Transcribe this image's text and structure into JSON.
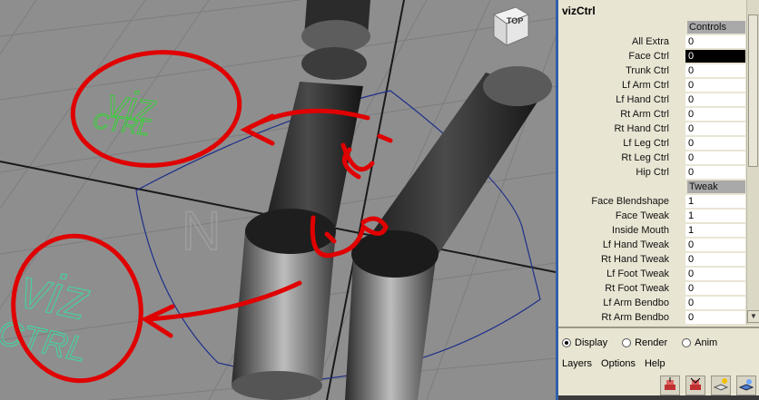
{
  "viewport": {
    "view_cube_label": "TOP",
    "view_cube_sub": "vizCtrl",
    "annotation_arrow_text": "من هنا"
  },
  "channel_box": {
    "title": "vizCtrl",
    "groups": [
      {
        "header": "Controls",
        "attributes": [
          {
            "label": "All Extra",
            "value": "0"
          },
          {
            "label": "Face Ctrl",
            "value": "0",
            "selected": true
          },
          {
            "label": "Trunk Ctrl",
            "value": "0"
          },
          {
            "label": "Lf Arm Ctrl",
            "value": "0"
          },
          {
            "label": "Lf Hand Ctrl",
            "value": "0"
          },
          {
            "label": "Rt Arm Ctrl",
            "value": "0"
          },
          {
            "label": "Rt Hand Ctrl",
            "value": "0"
          },
          {
            "label": "Lf Leg Ctrl",
            "value": "0"
          },
          {
            "label": "Rt Leg Ctrl",
            "value": "0"
          },
          {
            "label": "Hip Ctrl",
            "value": "0"
          }
        ]
      },
      {
        "header": "Tweak",
        "attributes": [
          {
            "label": "Face Blendshape",
            "value": "1"
          },
          {
            "label": "Face Tweak",
            "value": "1"
          },
          {
            "label": "Inside Mouth",
            "value": "1"
          },
          {
            "label": "Lf Hand Tweak",
            "value": "0"
          },
          {
            "label": "Rt Hand Tweak",
            "value": "0"
          },
          {
            "label": "Lf Foot Tweak",
            "value": "0"
          },
          {
            "label": "Rt Foot Tweak",
            "value": "0"
          },
          {
            "label": "Lf Arm Bendbo",
            "value": "0"
          },
          {
            "label": "Rt Arm Bendbo",
            "value": "0"
          }
        ]
      }
    ]
  },
  "layer_editor": {
    "modes": [
      {
        "label": "Display",
        "selected": true
      },
      {
        "label": "Render",
        "selected": false
      },
      {
        "label": "Anim",
        "selected": false
      }
    ],
    "menus": [
      "Layers",
      "Options",
      "Help"
    ],
    "tools": [
      "new-layer-icon",
      "new-layer-selected-icon",
      "create-layer-icon",
      "layer-options-icon"
    ]
  }
}
